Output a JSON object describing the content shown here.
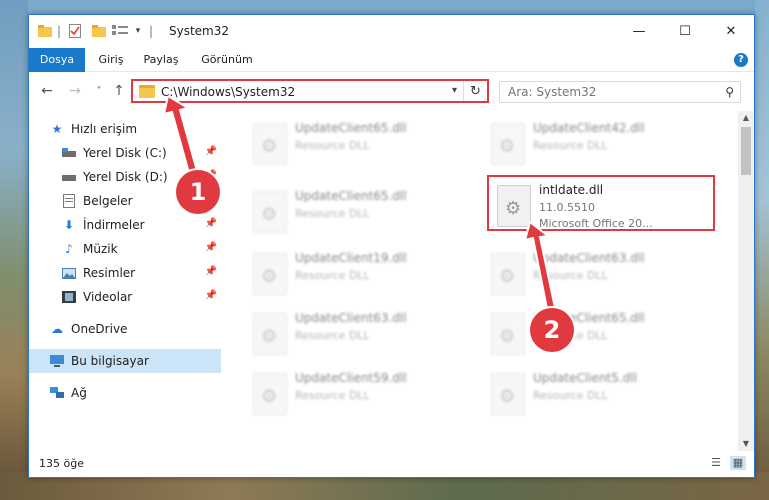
{
  "window": {
    "title": "System32",
    "controls": {
      "minimize": "—",
      "maximize": "☐",
      "close": "✕"
    }
  },
  "ribbon": {
    "tabs": [
      "Dosya",
      "Giriş",
      "Paylaş",
      "Görünüm"
    ],
    "help": "?"
  },
  "navigation": {
    "back": "←",
    "forward": "→",
    "recent": "˅",
    "up": "↑",
    "address": "C:\\Windows\\System32",
    "refresh": "↻",
    "search_placeholder": "Ara: System32"
  },
  "sidebar": {
    "quick_access": "Hızlı erişim",
    "items": [
      {
        "label": "Yerel Disk (C:)",
        "icon": "drive-icon"
      },
      {
        "label": "Yerel Disk (D:)",
        "icon": "drive-icon"
      },
      {
        "label": "Belgeler",
        "icon": "documents-icon"
      },
      {
        "label": "İndirmeler",
        "icon": "download-icon"
      },
      {
        "label": "Müzik",
        "icon": "music-icon"
      },
      {
        "label": "Resimler",
        "icon": "pictures-icon"
      },
      {
        "label": "Videolar",
        "icon": "videos-icon"
      }
    ],
    "onedrive": "OneDrive",
    "this_pc": "Bu bilgisayar",
    "network": "Ağ"
  },
  "files": {
    "left_column": [
      {
        "name": "UpdateClient65.dll",
        "desc": "Resource DLL"
      },
      {
        "name": "UpdateClient65.dll",
        "desc": "Resource DLL"
      },
      {
        "name": "UpdateClient19.dll",
        "desc": "Resource DLL"
      },
      {
        "name": "UpdateClient63.dll",
        "desc": "Resource DLL"
      },
      {
        "name": "UpdateClient59.dll",
        "desc": "Resource DLL"
      }
    ],
    "right_column": [
      {
        "name": "UpdateClient42.dll",
        "desc": "Resource DLL"
      },
      {
        "name": "UpdateClient63.dll",
        "desc": "Resource DLL"
      },
      {
        "name": "UpdateClient65.dll",
        "desc": "Resource DLL"
      },
      {
        "name": "UpdateClient5.dll",
        "desc": "Resource DLL"
      }
    ],
    "highlighted": {
      "name": "intldate.dll",
      "version": "11.0.5510",
      "company": "Microsoft Office 20..."
    }
  },
  "status": {
    "count": "135 öğe"
  },
  "annotations": {
    "step1": "1",
    "step2": "2",
    "accent": "#e03a40"
  }
}
